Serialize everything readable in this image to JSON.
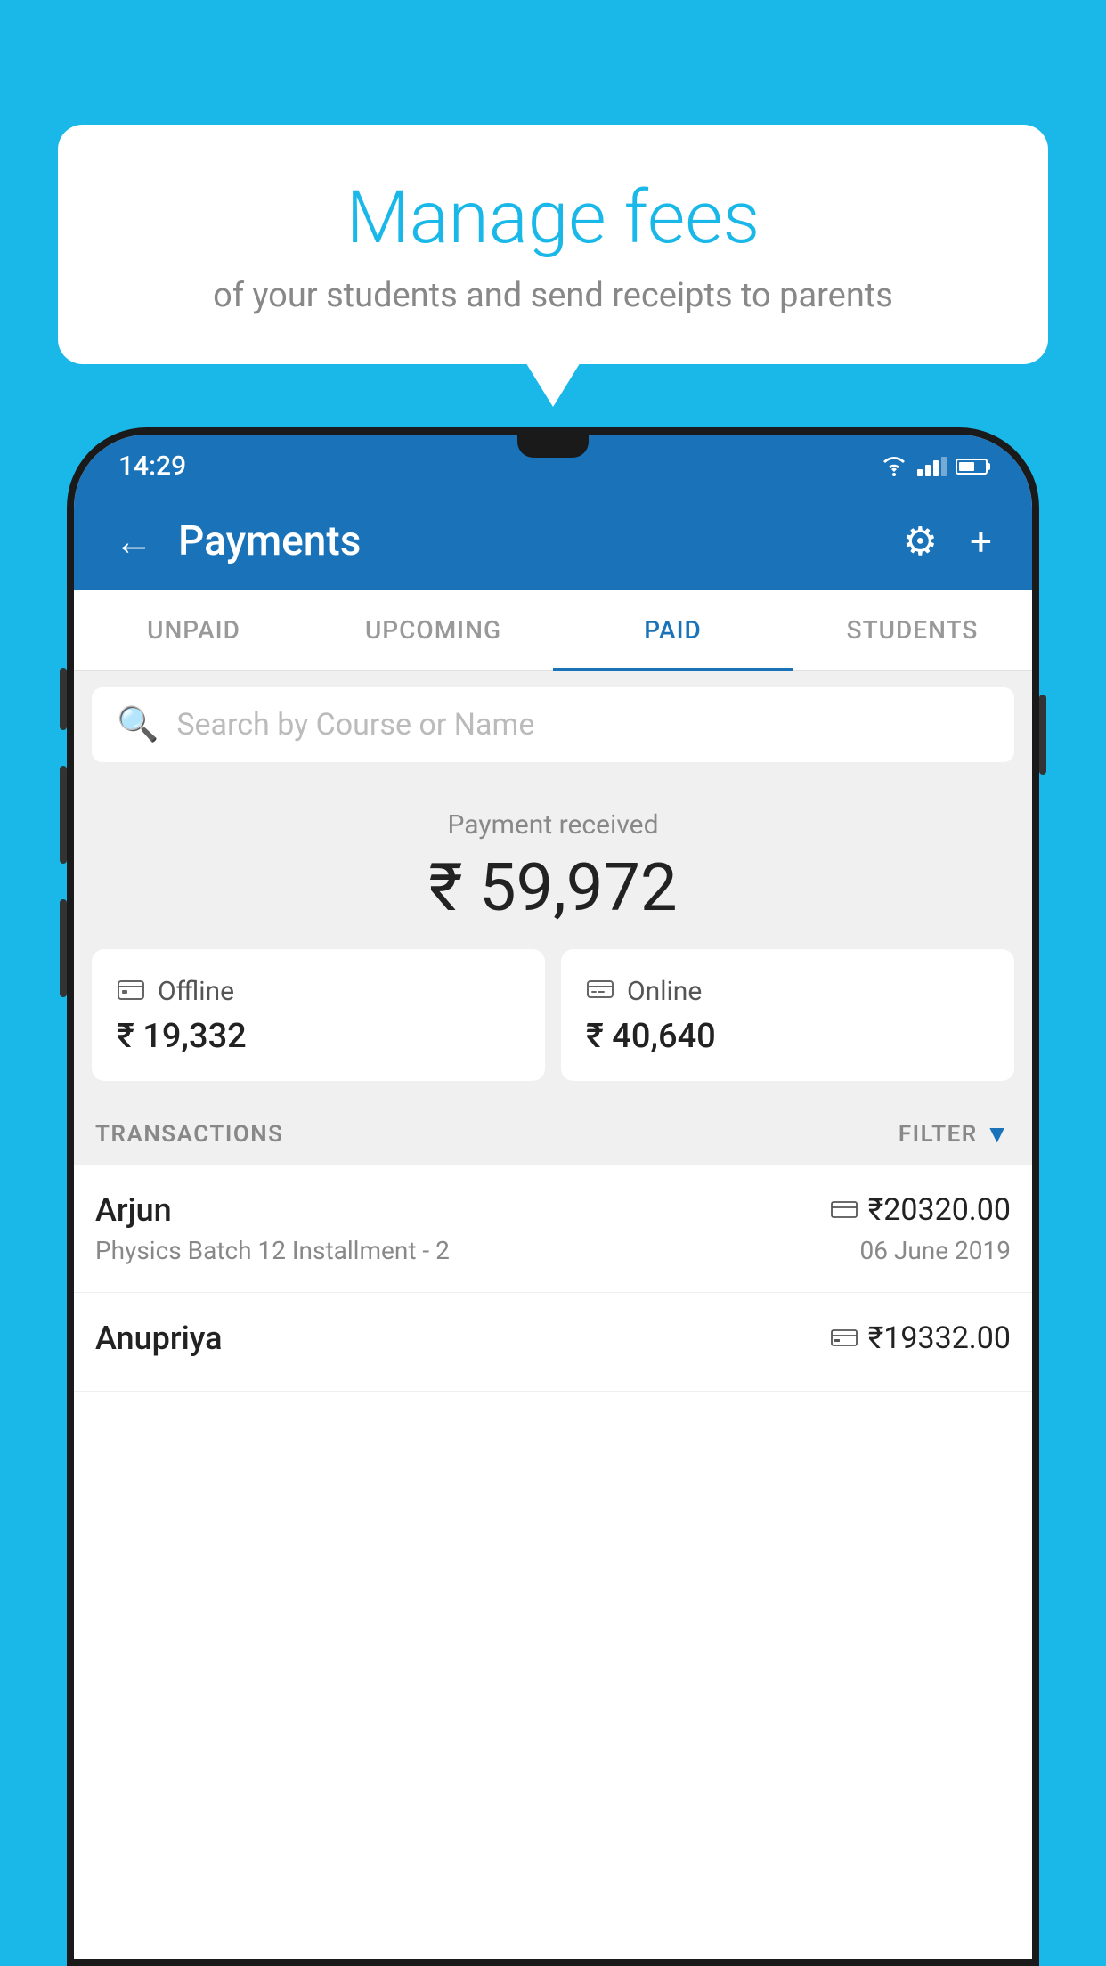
{
  "background_color": "#1ab8e8",
  "speech_bubble": {
    "title": "Manage fees",
    "subtitle": "of your students and send receipts to parents"
  },
  "status_bar": {
    "time": "14:29"
  },
  "app_header": {
    "title": "Payments",
    "back_label": "←",
    "settings_label": "⚙",
    "add_label": "+"
  },
  "tabs": [
    {
      "label": "UNPAID",
      "active": false
    },
    {
      "label": "UPCOMING",
      "active": false
    },
    {
      "label": "PAID",
      "active": true
    },
    {
      "label": "STUDENTS",
      "active": false
    }
  ],
  "search": {
    "placeholder": "Search by Course or Name"
  },
  "payment_received": {
    "label": "Payment received",
    "amount": "₹ 59,972"
  },
  "payment_cards": [
    {
      "label": "Offline",
      "amount": "₹ 19,332",
      "icon": "💳"
    },
    {
      "label": "Online",
      "amount": "₹ 40,640",
      "icon": "💳"
    }
  ],
  "transactions_section": {
    "label": "TRANSACTIONS",
    "filter_label": "FILTER"
  },
  "transactions": [
    {
      "name": "Arjun",
      "course": "Physics Batch 12 Installment - 2",
      "amount": "₹20320.00",
      "date": "06 June 2019",
      "payment_type": "online"
    },
    {
      "name": "Anupriya",
      "course": "",
      "amount": "₹19332.00",
      "date": "",
      "payment_type": "offline"
    }
  ]
}
